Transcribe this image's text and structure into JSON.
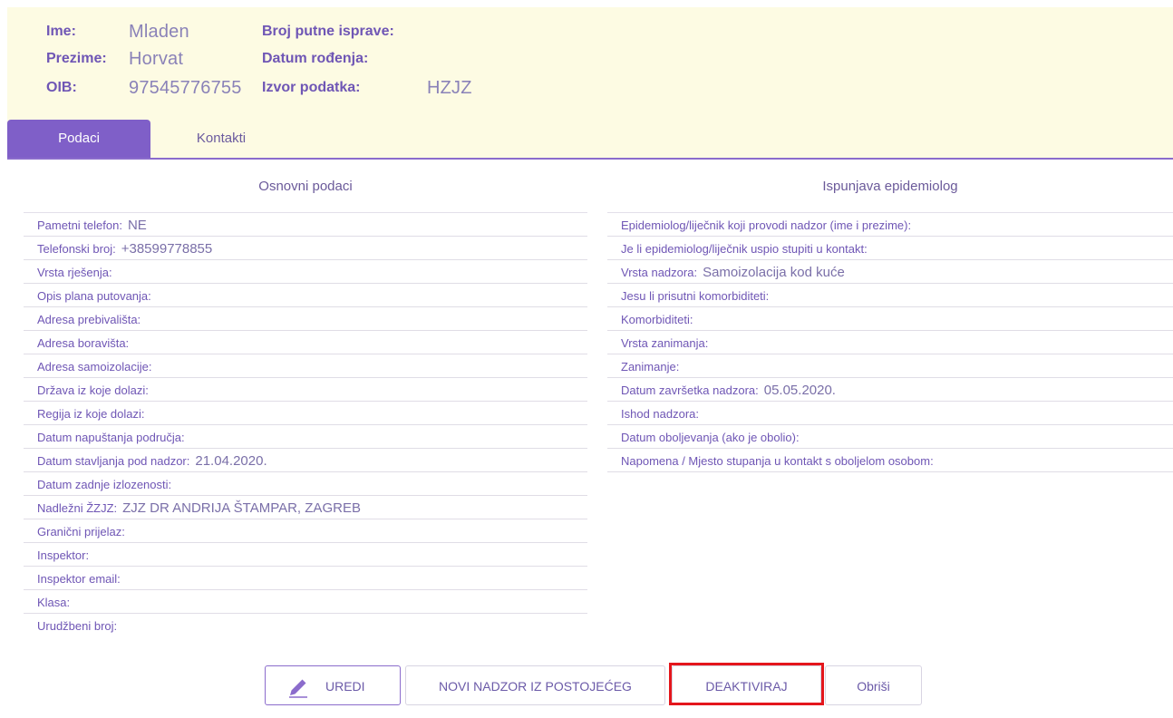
{
  "person": {
    "ime_label": "Ime:",
    "ime_value": "Mladen",
    "prezime_label": "Prezime:",
    "prezime_value": "Horvat",
    "oib_label": "OIB:",
    "oib_value": "97545776755",
    "broj_label": "Broj putne isprave:",
    "broj_value": "",
    "datum_label": "Datum rođenja:",
    "datum_value": "",
    "izvor_label": "Izvor podatka:",
    "izvor_value": "HZJZ"
  },
  "tabs": [
    {
      "label": "Podaci",
      "active": true
    },
    {
      "label": "Kontakti",
      "active": false
    }
  ],
  "left": {
    "title": "Osnovni podaci",
    "rows": [
      {
        "label": "Pametni telefon:",
        "value": "NE"
      },
      {
        "label": "Telefonski broj:",
        "value": "+38599778855"
      },
      {
        "label": "Vrsta rješenja:",
        "value": ""
      },
      {
        "label": "Opis plana putovanja:",
        "value": ""
      },
      {
        "label": "Adresa prebivališta:",
        "value": ""
      },
      {
        "label": "Adresa boravišta:",
        "value": ""
      },
      {
        "label": "Adresa samoizolacije:",
        "value": ""
      },
      {
        "label": "Država iz koje dolazi:",
        "value": ""
      },
      {
        "label": "Regija iz koje dolazi:",
        "value": ""
      },
      {
        "label": "Datum napuštanja područja:",
        "value": ""
      },
      {
        "label": "Datum stavljanja pod nadzor:",
        "value": "21.04.2020."
      },
      {
        "label": "Datum zadnje izlozenosti:",
        "value": ""
      },
      {
        "label": "Nadležni ŽZJZ:",
        "value": "ZJZ DR ANDRIJA ŠTAMPAR, ZAGREB"
      },
      {
        "label": "Granični prijelaz:",
        "value": ""
      },
      {
        "label": "Inspektor:",
        "value": ""
      },
      {
        "label": "Inspektor email:",
        "value": ""
      },
      {
        "label": "Klasa:",
        "value": ""
      },
      {
        "label": "Urudžbeni broj:",
        "value": ""
      }
    ]
  },
  "right": {
    "title": "Ispunjava epidemiolog",
    "rows": [
      {
        "label": "Epidemiolog/liječnik koji provodi nadzor (ime i prezime):",
        "value": ""
      },
      {
        "label": "Je li epidemiolog/liječnik uspio stupiti u kontakt:",
        "value": ""
      },
      {
        "label": "Vrsta nadzora:",
        "value": "Samoizolacija kod kuće"
      },
      {
        "label": "Jesu li prisutni komorbiditeti:",
        "value": ""
      },
      {
        "label": "Komorbiditeti:",
        "value": ""
      },
      {
        "label": "Vrsta zanimanja:",
        "value": ""
      },
      {
        "label": "Zanimanje:",
        "value": ""
      },
      {
        "label": "Datum završetka nadzora:",
        "value": "05.05.2020."
      },
      {
        "label": "Ishod nadzora:",
        "value": ""
      },
      {
        "label": "Datum oboljevanja (ako je obolio):",
        "value": ""
      },
      {
        "label": "Napomena / Mjesto stupanja u kontakt s oboljelom osobom:",
        "value": ""
      }
    ]
  },
  "actions": {
    "uredi": "UREDI",
    "novi": "NOVI NADZOR IZ POSTOJEĆEG",
    "deaktiviraj": "DEAKTIVIRAJ",
    "obrisi": "Obriši"
  },
  "colors": {
    "accent": "#7f5fc8",
    "header_bg": "#fdfbe3",
    "highlight": "#e4161c"
  }
}
